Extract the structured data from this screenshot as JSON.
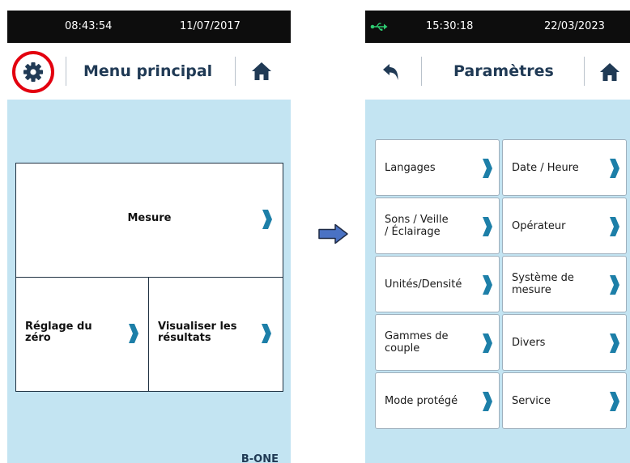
{
  "left_screen": {
    "status": {
      "time": "08:43:54",
      "date": "11/07/2017"
    },
    "header": {
      "title": "Menu principal"
    },
    "tiles": {
      "mesure": "Mesure",
      "zero_line1": "Réglage du",
      "zero_line2": "zéro",
      "results_line1": "Visualiser les",
      "results_line2": "résultats"
    },
    "brand": "B-ONE",
    "highlight_color": "#e3000f"
  },
  "right_screen": {
    "status": {
      "time": "15:30:18",
      "date": "22/03/2023"
    },
    "header": {
      "title": "Paramètres"
    },
    "items": [
      {
        "line1": "Langages",
        "line2": ""
      },
      {
        "line1": "Date / Heure",
        "line2": ""
      },
      {
        "line1": "Sons / Veille",
        "line2": "/ Éclairage"
      },
      {
        "line1": "Opérateur",
        "line2": ""
      },
      {
        "line1": "Unités/Densité",
        "line2": ""
      },
      {
        "line1": "Système de",
        "line2": "mesure"
      },
      {
        "line1": "Gammes de",
        "line2": "couple"
      },
      {
        "line1": "Divers",
        "line2": ""
      },
      {
        "line1": "Mode protégé",
        "line2": ""
      },
      {
        "line1": "Service",
        "line2": ""
      }
    ]
  },
  "icons": {
    "settings": "gear-icon",
    "home": "home-icon",
    "back": "back-arrow-icon",
    "usb": "usb-icon",
    "chevron": "chevron-right-icon",
    "transition": "arrow-right-icon"
  },
  "colors": {
    "header_text": "#203a55",
    "content_bg": "#c3e4f2",
    "chevron": "#1d7fa8",
    "status_bg": "#0d0d0d",
    "usb": "#2ecc71",
    "arrow_fill": "#4a72c4"
  }
}
